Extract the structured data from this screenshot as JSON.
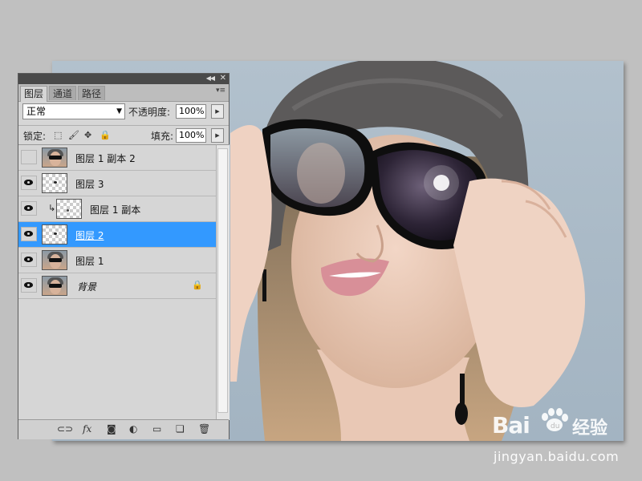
{
  "panel": {
    "tabs": [
      "图层",
      "通道",
      "路径"
    ],
    "blend_mode": "正常",
    "opacity_label": "不透明度:",
    "opacity_value": "100%",
    "lock_label": "锁定:",
    "fill_label": "填充:",
    "fill_value": "100%",
    "layers": [
      {
        "name": "图层 1 副本 2",
        "visible": false,
        "thumb": "photo"
      },
      {
        "name": "图层 3",
        "visible": true,
        "thumb": "transparent-dot"
      },
      {
        "name": "图层 1 副本",
        "visible": true,
        "thumb": "transparent-dot",
        "clipped": true
      },
      {
        "name": "图层 2",
        "visible": true,
        "thumb": "transparent-dot",
        "selected": true
      },
      {
        "name": "图层 1",
        "visible": true,
        "thumb": "photo"
      },
      {
        "name": "背景",
        "visible": true,
        "thumb": "photo",
        "locked": true
      }
    ],
    "footer_icons": [
      "link-icon",
      "fx-icon",
      "mask-icon",
      "adjustment-icon",
      "folder-icon",
      "new-layer-icon",
      "trash-icon"
    ]
  },
  "watermark": {
    "brand_left": "Bai",
    "brand_right": "经验",
    "url": "jingyan.baidu.com"
  },
  "colors": {
    "selection": "#3399ff",
    "panel_bg": "#d6d6d6",
    "workspace_bg": "#c0c0c0"
  }
}
